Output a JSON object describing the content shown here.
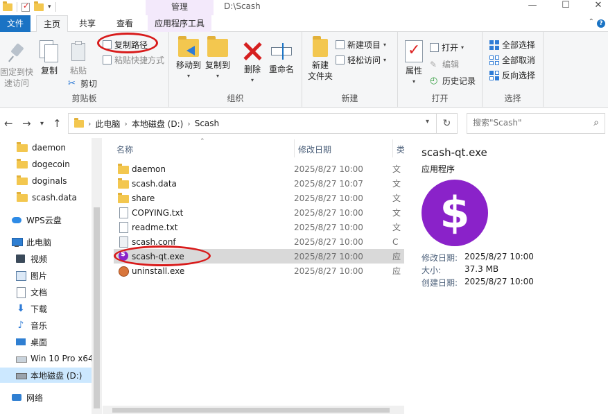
{
  "window": {
    "title_path": "D:\\Scash",
    "contextual_tab_group": "管理",
    "min_glyph": "—",
    "max_glyph": "☐",
    "close_glyph": "✕"
  },
  "tabs": {
    "file": "文件",
    "home": "主页",
    "share": "共享",
    "view": "查看",
    "app_tools": "应用程序工具"
  },
  "ribbon": {
    "clipboard": {
      "label": "剪贴板",
      "pin_line1": "固定到快",
      "pin_line2": "速访问",
      "copy": "复制",
      "paste": "粘贴",
      "copy_path": "复制路径",
      "paste_shortcut": "粘贴快捷方式",
      "cut": "剪切"
    },
    "organize": {
      "label": "组织",
      "move_to": "移动到",
      "copy_to": "复制到",
      "delete": "删除",
      "rename": "重命名"
    },
    "new": {
      "label": "新建",
      "new_folder_line1": "新建",
      "new_folder_line2": "文件夹",
      "new_item": "新建项目",
      "easy_access": "轻松访问"
    },
    "open": {
      "label": "打开",
      "properties": "属性",
      "open": "打开",
      "edit": "编辑",
      "history": "历史记录"
    },
    "select": {
      "label": "选择",
      "select_all": "全部选择",
      "select_none": "全部取消",
      "invert": "反向选择"
    }
  },
  "address": {
    "crumbs": [
      "此电脑",
      "本地磁盘 (D:)",
      "Scash"
    ],
    "search_placeholder": "搜索\"Scash\""
  },
  "nav": {
    "items": [
      {
        "label": "daemon",
        "icon": "folder-icon"
      },
      {
        "label": "dogecoin",
        "icon": "folder-icon"
      },
      {
        "label": "doginals",
        "icon": "folder-icon"
      },
      {
        "label": "scash.data",
        "icon": "folder-icon"
      },
      {
        "label": "WPS云盘",
        "icon": "cloud-icon"
      },
      {
        "label": "此电脑",
        "icon": "computer-icon"
      },
      {
        "label": "视频",
        "icon": "video-icon"
      },
      {
        "label": "图片",
        "icon": "picture-icon"
      },
      {
        "label": "文档",
        "icon": "document-icon"
      },
      {
        "label": "下载",
        "icon": "download-icon"
      },
      {
        "label": "音乐",
        "icon": "music-icon"
      },
      {
        "label": "桌面",
        "icon": "desktop-icon"
      },
      {
        "label": "Win 10 Pro x64",
        "icon": "os-drive-icon"
      },
      {
        "label": "本地磁盘 (D:)",
        "icon": "drive-icon"
      },
      {
        "label": "网络",
        "icon": "network-icon"
      }
    ]
  },
  "filelist": {
    "columns": {
      "name": "名称",
      "date": "修改日期",
      "type": "类"
    },
    "rows": [
      {
        "name": "daemon",
        "date": "2025/8/27 10:00",
        "type": "文"
      },
      {
        "name": "scash.data",
        "date": "2025/8/27 10:07",
        "type": "文"
      },
      {
        "name": "share",
        "date": "2025/8/27 10:00",
        "type": "文"
      },
      {
        "name": "COPYING.txt",
        "date": "2025/8/27 10:00",
        "type": "文"
      },
      {
        "name": "readme.txt",
        "date": "2025/8/27 10:00",
        "type": "文"
      },
      {
        "name": "scash.conf",
        "date": "2025/8/27 10:00",
        "type": "C"
      },
      {
        "name": "scash-qt.exe",
        "date": "2025/8/27 10:00",
        "type": "应"
      },
      {
        "name": "uninstall.exe",
        "date": "2025/8/27 10:00",
        "type": "应"
      }
    ],
    "selected_index": 6
  },
  "preview": {
    "name": "scash-qt.exe",
    "type": "应用程序",
    "icon_glyph": "$",
    "modified_label": "修改日期:",
    "modified": "2025/8/27 10:00",
    "size_label": "大小:",
    "size": "37.3 MB",
    "created_label": "创建日期:",
    "created": "2025/8/27 10:00"
  },
  "colors": {
    "accent": "#1a73c4",
    "app_tools_tab": "#f3e9fb",
    "selection": "#d9d9d9",
    "scash_purple": "#8a22c9",
    "annotation_red": "#d81b1b"
  }
}
